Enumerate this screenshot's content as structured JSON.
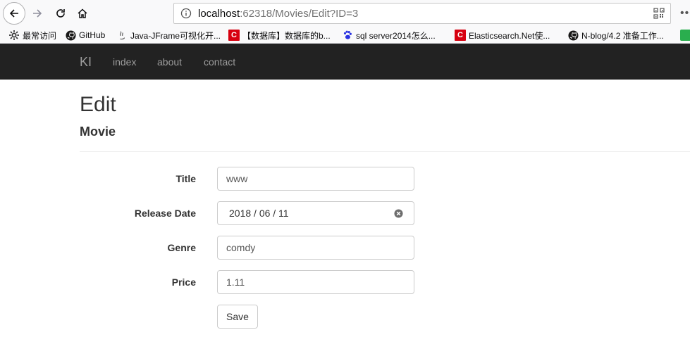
{
  "browser": {
    "url_host": "localhost",
    "url_path": ":62318/Movies/Edit?ID=3"
  },
  "bookmarks": [
    {
      "label": "最常访问",
      "icon": "gear-icon"
    },
    {
      "label": "GitHub",
      "icon": "github-icon"
    },
    {
      "label": "Java-JFrame可视化开...",
      "icon": "java-icon"
    },
    {
      "label": "【数据库】数据库的b...",
      "icon": "c-logo-icon"
    },
    {
      "label": "sql server2014怎么...",
      "icon": "baidu-paw-icon"
    },
    {
      "label": "Elasticsearch.Net使...",
      "icon": "c-logo-icon"
    },
    {
      "label": "N-blog/4.2 准备工作...",
      "icon": "github-icon"
    }
  ],
  "navbar": {
    "brand": "KI",
    "links": [
      "index",
      "about",
      "contact"
    ]
  },
  "page": {
    "title": "Edit",
    "subtitle": "Movie"
  },
  "form": {
    "title_label": "Title",
    "title_value": "www",
    "release_label": "Release Date",
    "release_value": "2018 / 06 / 11",
    "genre_label": "Genre",
    "genre_value": "comdy",
    "price_label": "Price",
    "price_value": "1.11",
    "save_label": "Save"
  },
  "colors": {
    "navbar_bg": "#222222",
    "navbar_text": "#9d9d9d",
    "accent_red": "#d7000f"
  }
}
